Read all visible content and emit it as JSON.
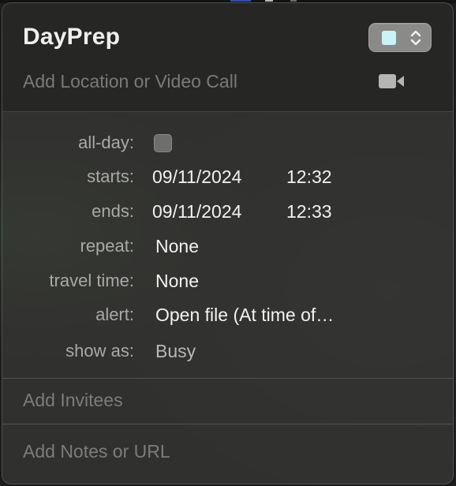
{
  "event": {
    "title": "DayPrep",
    "location_placeholder": "Add Location or Video Call",
    "calendar_color": "#c9f4f7",
    "calendar_picker_icon": "chevron-up-down-icon",
    "video_call_icon": "video-camera-icon"
  },
  "fields": {
    "all_day": {
      "label": "all-day:",
      "checked": false
    },
    "starts": {
      "label": "starts:",
      "date": "09/11/2024",
      "time": "12:32"
    },
    "ends": {
      "label": "ends:",
      "date": "09/11/2024",
      "time": "12:33"
    },
    "repeat": {
      "label": "repeat:",
      "value": "None"
    },
    "travel_time": {
      "label": "travel time:",
      "value": "None"
    },
    "alert": {
      "label": "alert:",
      "value": "Open file (At time of…"
    },
    "show_as": {
      "label": "show as:",
      "value": "Busy"
    }
  },
  "invitees": {
    "placeholder": "Add Invitees"
  },
  "notes": {
    "placeholder": "Add Notes or URL"
  }
}
